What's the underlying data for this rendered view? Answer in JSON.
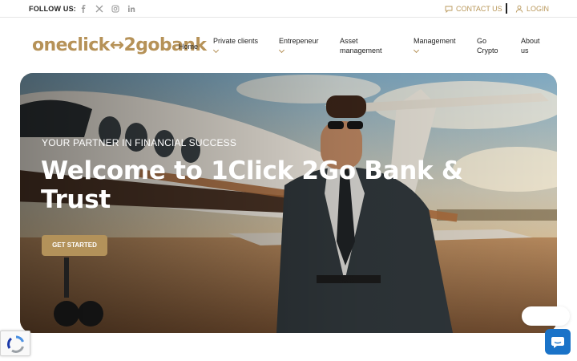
{
  "topbar": {
    "follow_label": "FOLLOW US:",
    "social_icons": [
      "facebook-icon",
      "x-icon",
      "instagram-icon",
      "linkedin-icon"
    ],
    "contact_label": "CONTACT US",
    "login_label": "LOGIN"
  },
  "header": {
    "logo_text": "oneclick↔2gobank",
    "nav": [
      {
        "label": "Home",
        "has_dropdown": false
      },
      {
        "label": "Private clients",
        "has_dropdown": true
      },
      {
        "label": "Entrepeneur",
        "has_dropdown": true
      },
      {
        "label": "Asset management",
        "has_dropdown": false
      },
      {
        "label": "Management",
        "has_dropdown": true
      },
      {
        "label": "Go Crypto",
        "has_dropdown": false
      },
      {
        "label": "About us",
        "has_dropdown": false
      }
    ]
  },
  "hero": {
    "tagline": "YOUR PARTNER IN FINANCIAL SUCCESS",
    "headline": "Welcome to 1Click 2Go Bank & Trust",
    "cta_label": "GET STARTED"
  },
  "colors": {
    "accent": "#b69258",
    "chat_button": "#1a73c8"
  }
}
